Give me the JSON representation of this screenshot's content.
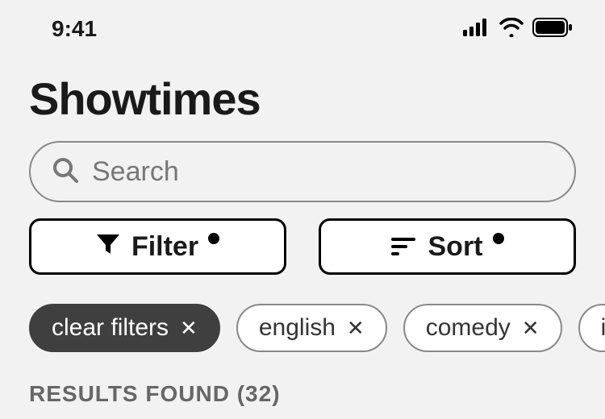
{
  "status": {
    "time": "9:41"
  },
  "page": {
    "title": "Showtimes"
  },
  "search": {
    "placeholder": "Search"
  },
  "controls": {
    "filter_label": "Filter",
    "sort_label": "Sort"
  },
  "chips": {
    "clear": "clear filters",
    "items": [
      "english",
      "comedy",
      "imax"
    ]
  },
  "results": {
    "label": "RESULTS FOUND",
    "count": 32
  }
}
